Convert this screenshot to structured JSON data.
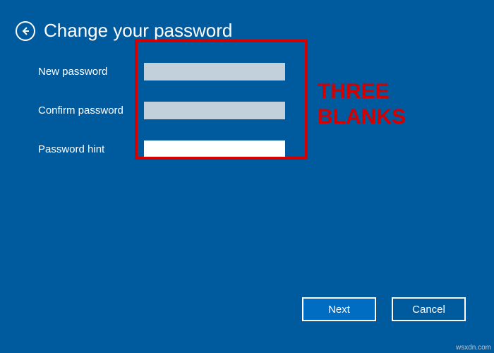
{
  "header": {
    "title": "Change your password"
  },
  "form": {
    "new_password_label": "New password",
    "new_password_value": "",
    "confirm_password_label": "Confirm password",
    "confirm_password_value": "",
    "hint_label": "Password hint",
    "hint_value": ""
  },
  "annotation": {
    "text": "THREE\nBLANKS"
  },
  "footer": {
    "next_label": "Next",
    "cancel_label": "Cancel"
  },
  "watermark": "wsxdn.com",
  "colors": {
    "background": "#005a9e",
    "highlight": "#d40000",
    "primary_button": "#006cc2"
  }
}
